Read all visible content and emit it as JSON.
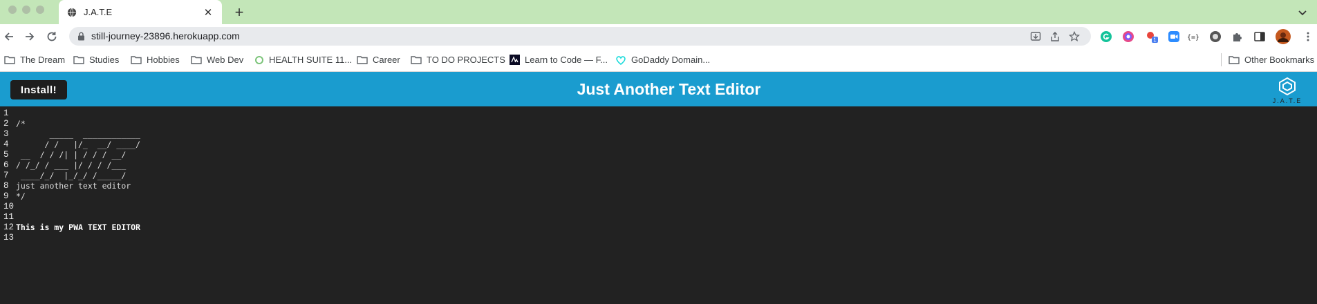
{
  "colors": {
    "tabstrip": "#c3e6b8",
    "app_header": "#1a9ccf",
    "editor_bg": "#222222",
    "install_button": "#1e1e1e"
  },
  "browser": {
    "tab": {
      "title": "J.A.T.E",
      "favicon": "globe-icon"
    },
    "address": "still-journey-23896.herokuapp.com",
    "bookmarks": [
      {
        "label": "The Dream",
        "icon": "folder-icon"
      },
      {
        "label": "Studies",
        "icon": "folder-icon"
      },
      {
        "label": "Hobbies",
        "icon": "folder-icon"
      },
      {
        "label": "Web Dev",
        "icon": "folder-icon"
      },
      {
        "label": "HEALTH SUITE 11...",
        "icon": "site-icon"
      },
      {
        "label": "Career",
        "icon": "folder-icon"
      },
      {
        "label": "TO DO PROJECTS",
        "icon": "folder-icon"
      },
      {
        "label": "Learn to Code — F...",
        "icon": "site-icon"
      },
      {
        "label": "GoDaddy Domain...",
        "icon": "site-icon"
      }
    ],
    "other_bookmarks": "Other Bookmarks",
    "extension_badge": "1"
  },
  "app": {
    "install_label": "Install!",
    "title": "Just Another Text Editor",
    "logo_text": "J.A.T.E"
  },
  "editor": {
    "lines": [
      {
        "n": "1",
        "text": ""
      },
      {
        "n": "2",
        "text": "/*"
      },
      {
        "n": "3",
        "text": "       _____  ____________"
      },
      {
        "n": "4",
        "text": "      / /   |/_  __/ ____/"
      },
      {
        "n": "5",
        "text": " __  / / /| | / / / __/"
      },
      {
        "n": "6",
        "text": "/ /_/ / ___ |/ / / /___"
      },
      {
        "n": "7",
        "text": " ____/_/  |_/_/ /_____/"
      },
      {
        "n": "8",
        "text": "just another text editor"
      },
      {
        "n": "9",
        "text": "*/"
      },
      {
        "n": "10",
        "text": ""
      },
      {
        "n": "11",
        "text": ""
      },
      {
        "n": "12",
        "text": "This is my PWA TEXT EDITOR"
      },
      {
        "n": "13",
        "text": ""
      }
    ]
  }
}
